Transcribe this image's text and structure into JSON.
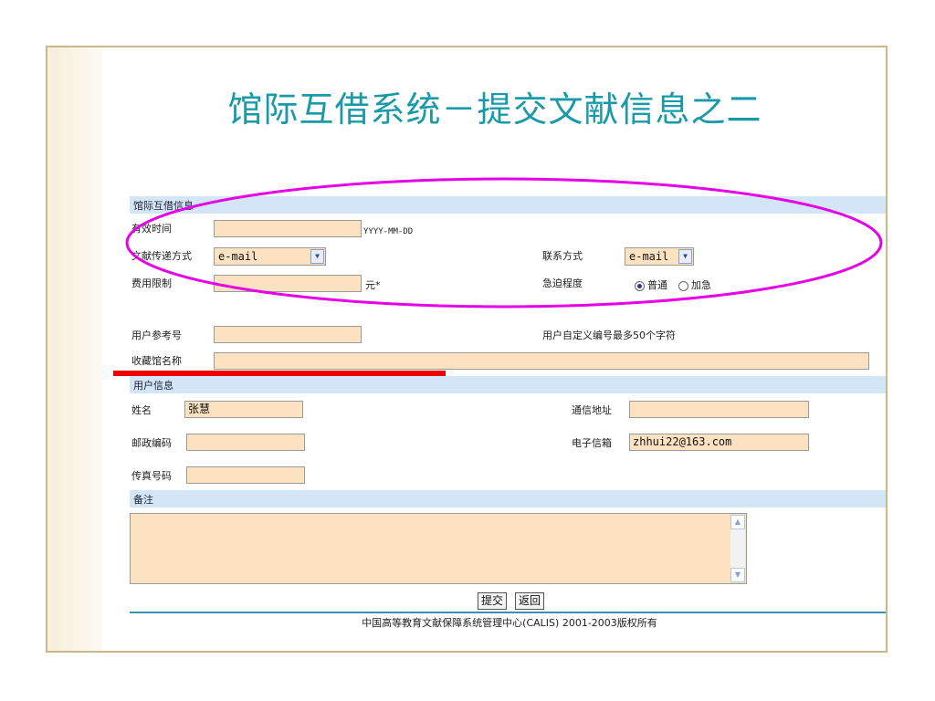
{
  "title": "馆际互借系统－提交文献信息之二",
  "ill_section": {
    "header": "馆际互借信息",
    "valid_time_label": "有效时间",
    "valid_time_value": "",
    "date_format_hint": "YYYY-MM-DD",
    "delivery_label": "文献传递方式",
    "delivery_value": "e-mail",
    "contact_label": "联系方式",
    "contact_value": "e-mail",
    "fee_label": "费用限制",
    "fee_value": "",
    "fee_unit": "元*",
    "urgency_label": "急迫程度",
    "urgency_options": [
      "普通",
      "加急"
    ],
    "urgency_selected": "普通"
  },
  "reference": {
    "user_ref_label": "用户参考号",
    "user_ref_value": "",
    "user_ref_hint": "用户自定义编号最多50个字符",
    "library_label": "收藏馆名称",
    "library_value": ""
  },
  "user_section": {
    "header": "用户信息",
    "name_label": "姓名",
    "name_value": "张慧",
    "address_label": "通信地址",
    "address_value": "",
    "postcode_label": "邮政编码",
    "postcode_value": "",
    "email_label": "电子信箱",
    "email_value": "zhhui22@163.com",
    "fax_label": "传真号码",
    "fax_value": ""
  },
  "remarks": {
    "header": "备注",
    "value": ""
  },
  "buttons": {
    "submit": "提交",
    "back": "返回"
  },
  "footer": "中国高等教育文献保障系统管理中心(CALIS) 2001-2003版权所有",
  "colors": {
    "title": "#1a9aa8",
    "section_bar": "#d3e6f8",
    "input_fill": "#fde2c2",
    "annotation_ellipse": "#e600e6",
    "annotation_underline": "#ee0000"
  },
  "icons": {
    "dropdown": "chevron-down-icon",
    "scroll_up": "arrow-up-icon",
    "scroll_down": "arrow-down-icon"
  }
}
